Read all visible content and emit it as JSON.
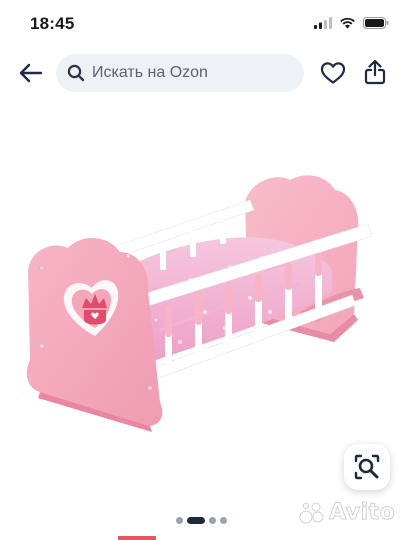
{
  "status_bar": {
    "time": "18:45",
    "icons": [
      "signal-icon",
      "wifi-icon",
      "battery-icon"
    ]
  },
  "search": {
    "placeholder": "Искать на Ozon",
    "icons": [
      "back-arrow-icon",
      "search-icon",
      "heart-icon",
      "share-icon"
    ],
    "accent_color": "#1f2a44"
  },
  "product_image": {
    "description_icon": "doll-cradle-photo",
    "gallery_total": 4,
    "gallery_active": 2
  },
  "image_search_button": {
    "icon": "image-search-icon"
  },
  "watermark": {
    "text": "Avito"
  },
  "colors": {
    "search_bg": "#eef1f6",
    "cradle_pink": "#f5a9bb",
    "rails_white": "#ffffff",
    "dot_active": "#1f2937",
    "dot_inactive": "#9aa2ad"
  }
}
